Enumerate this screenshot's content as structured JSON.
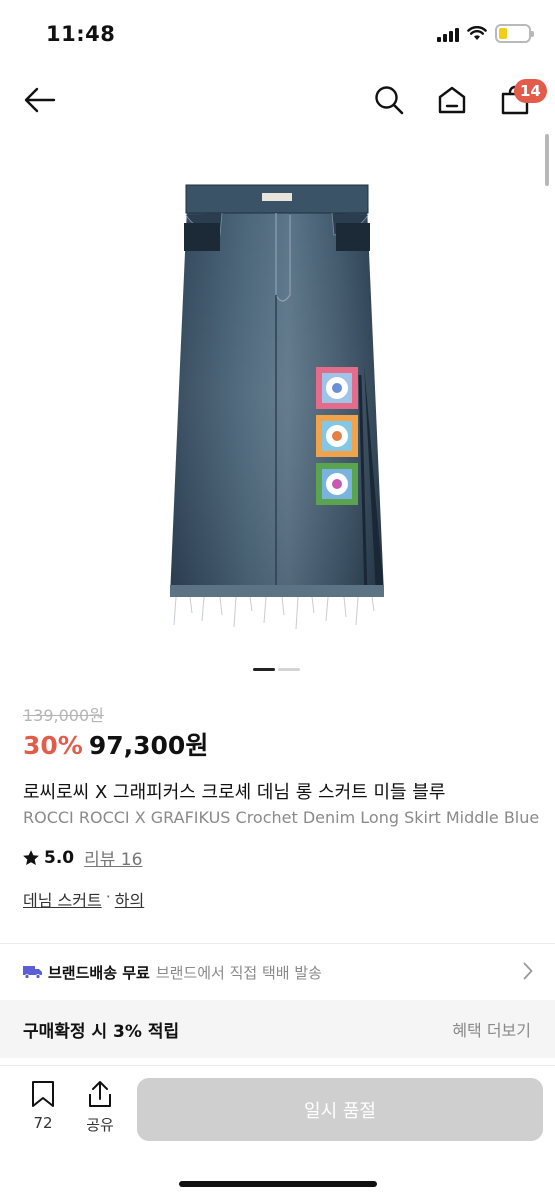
{
  "status_bar": {
    "time": "11:48",
    "icons": [
      "signal-icon",
      "wifi-icon",
      "battery-icon"
    ],
    "battery_color": "#f5cd14"
  },
  "nav": {
    "cart_count": "14",
    "icons": [
      "back-arrow-icon",
      "search-icon",
      "home-icon",
      "cart-icon"
    ],
    "badge_color": "#e35c4a"
  },
  "product": {
    "original_price": "139,000원",
    "discount": "30%",
    "sale_price": "97,300원",
    "title_ko": "로씨로씨 X 그래피커스 크로셰 데님 롱 스커트 미들 블루",
    "title_en": "ROCCI ROCCI X GRAFIKUS Crochet Denim Long Skirt Middle Blue",
    "rating": "5.0",
    "review_text": "리뷰 16",
    "category": "데님 스커트",
    "category_sep": "·",
    "parent_category": "하의",
    "image_count": 2,
    "image_active": 1
  },
  "shipping": {
    "main": "브랜드배송 무료",
    "sub": "브랜드에서 직접 택배 발송"
  },
  "benefit": {
    "main": "구매확정 시 3% 적립",
    "more": "혜택 더보기"
  },
  "bottom": {
    "bookmark_count": "72",
    "share_label": "공유",
    "soldout_label": "일시 품절"
  },
  "colors": {
    "accent": "#e35c4a",
    "disabled_button": "#cfcfcf",
    "denim": "#3a5068"
  }
}
